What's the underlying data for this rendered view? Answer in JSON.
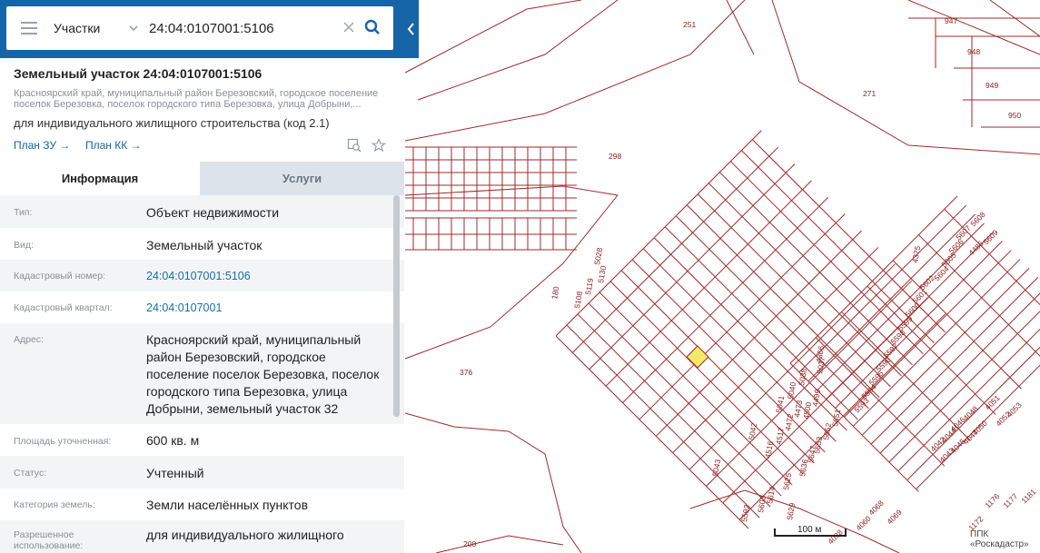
{
  "search": {
    "type_label": "Участки",
    "query": "24:04:0107001:5106"
  },
  "parcel": {
    "title": "Земельный участок 24:04:0107001:5106",
    "address_short": "Красноярский край, муниципальный район Березовский, городское поселение поселок Березовка, поселок городского типа Березовка, улица Добрыни,...",
    "permitted_use": "для индивидуального жилищного строительства (код 2.1)",
    "plan_zu": "План ЗУ →",
    "plan_kk": "План КК →"
  },
  "tabs": {
    "info": "Информация",
    "services": "Услуги"
  },
  "info_rows": [
    {
      "label": "Тип:",
      "value": "Объект недвижимости"
    },
    {
      "label": "Вид:",
      "value": "Земельный участок"
    },
    {
      "label": "Кадастровый номер:",
      "value": "24:04:0107001:5106"
    },
    {
      "label": "Кадастровый квартал:",
      "value": "24:04:0107001"
    },
    {
      "label": "Адрес:",
      "value": "Красноярский край, муниципальный район Березовский, городское поселение поселок Березовка, поселок городского типа Березовка, улица Добрыни, земельный участок 32"
    },
    {
      "label": "Площадь уточненная:",
      "value": "600 кв. м"
    },
    {
      "label": "Статус:",
      "value": "Учтенный"
    },
    {
      "label": "Категория земель:",
      "value": "Земли населённых пунктов"
    },
    {
      "label": "Разрешенное использование:",
      "value": "для индивидуального жилищного"
    }
  ],
  "map": {
    "parcel_labels": [
      "251",
      "271",
      "298",
      "180",
      "376",
      "208",
      "947",
      "948",
      "949",
      "950",
      "5028",
      "5130",
      "5119",
      "5108",
      "5037",
      "5038",
      "5040",
      "5041",
      "5042",
      "5043",
      "4366",
      "4375",
      "4500",
      "4499",
      "4473",
      "4472",
      "4517",
      "4516",
      "5593",
      "5594",
      "5595",
      "5596",
      "5597",
      "5598",
      "5599",
      "5600",
      "5601",
      "5602",
      "5604",
      "5605",
      "5606",
      "5607",
      "5608",
      "5609",
      "4486",
      "5651",
      "5652",
      "5653",
      "5647",
      "5636",
      "5625",
      "5614",
      "5603",
      "5592",
      "5629",
      "4042",
      "4044",
      "4046",
      "4048",
      "4051",
      "4043",
      "4045",
      "4047",
      "4050",
      "4052",
      "4053",
      "4068",
      "4069",
      "4060",
      "4038",
      "1176",
      "1177",
      "1181",
      "1172"
    ],
    "scale_label": "100 м",
    "copyright": "ППК «Роскадастр»",
    "colors": {
      "boundary": "#a12a2a",
      "label": "#8a1c1c",
      "selected_fill": "#f3ea6a",
      "panel_accent": "#1565a8"
    }
  }
}
